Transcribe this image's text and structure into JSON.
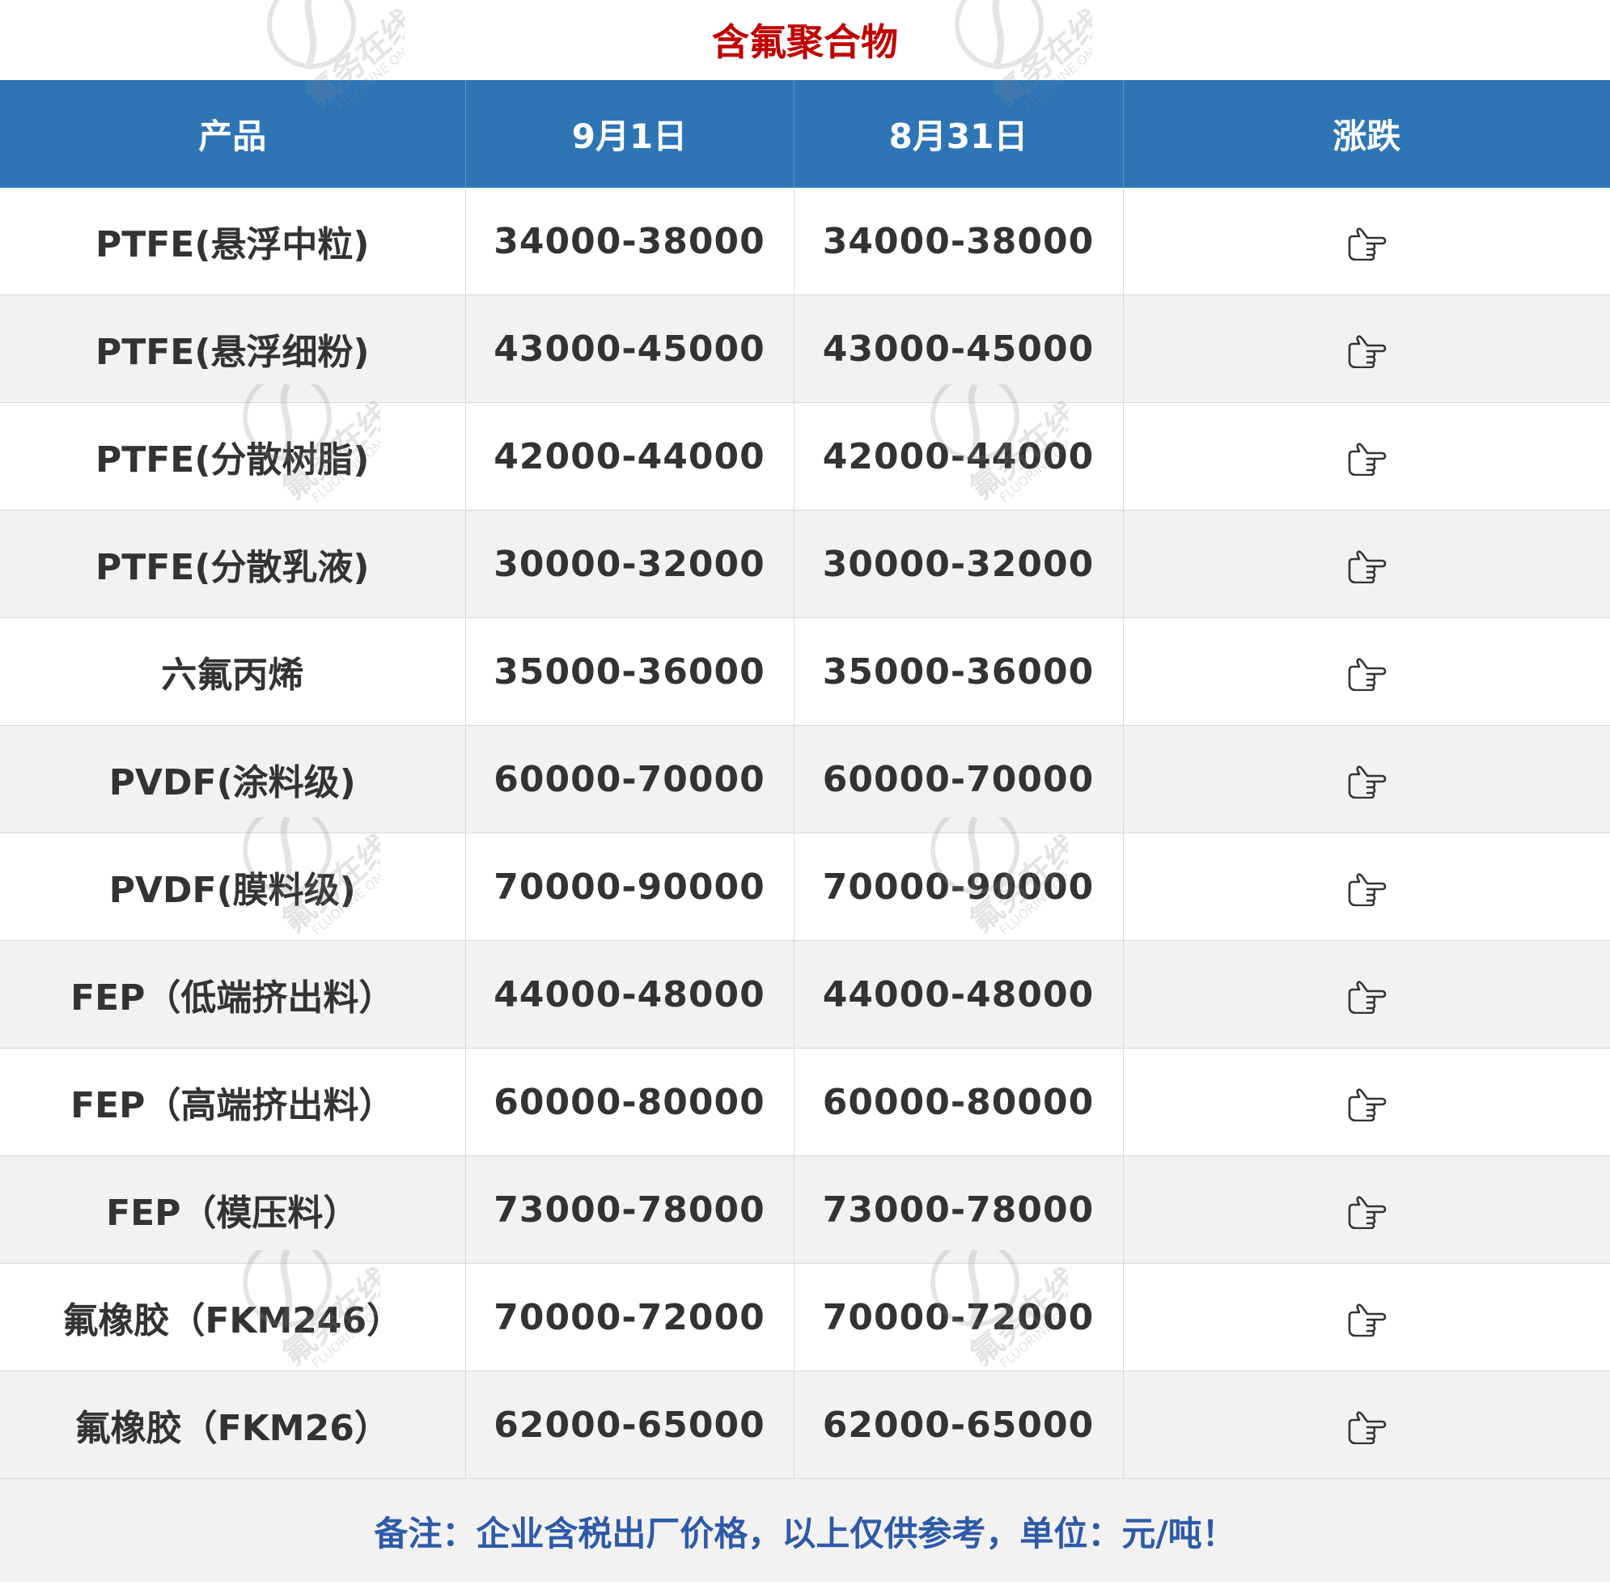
{
  "title": "含氟聚合物",
  "table": {
    "headers": [
      "产品",
      "9月1日",
      "8月31日",
      "涨跌"
    ],
    "rows": [
      {
        "product": "PTFE(悬浮中粒)",
        "sep1": "34000-38000",
        "aug31": "34000-38000",
        "change": "hand-pointing-right-icon"
      },
      {
        "product": "PTFE(悬浮细粉)",
        "sep1": "43000-45000",
        "aug31": "43000-45000",
        "change": "hand-pointing-right-icon"
      },
      {
        "product": "PTFE(分散树脂)",
        "sep1": "42000-44000",
        "aug31": "42000-44000",
        "change": "hand-pointing-right-icon"
      },
      {
        "product": "PTFE(分散乳液)",
        "sep1": "30000-32000",
        "aug31": "30000-32000",
        "change": "hand-pointing-right-icon"
      },
      {
        "product": "六氟丙烯",
        "sep1": "35000-36000",
        "aug31": "35000-36000",
        "change": "hand-pointing-right-icon"
      },
      {
        "product": "PVDF(涂料级)",
        "sep1": "60000-70000",
        "aug31": "60000-70000",
        "change": "hand-pointing-right-icon"
      },
      {
        "product": "PVDF(膜料级)",
        "sep1": "70000-90000",
        "aug31": "70000-90000",
        "change": "hand-pointing-right-icon"
      },
      {
        "product": "FEP（低端挤出料）",
        "sep1": "44000-48000",
        "aug31": "44000-48000",
        "change": "hand-pointing-right-icon"
      },
      {
        "product": "FEP（高端挤出料）",
        "sep1": "60000-80000",
        "aug31": "60000-80000",
        "change": "hand-pointing-right-icon"
      },
      {
        "product": "FEP（模压料）",
        "sep1": "73000-78000",
        "aug31": "73000-78000",
        "change": "hand-pointing-right-icon"
      },
      {
        "product": "氟橡胶（FKM246）",
        "sep1": "70000-72000",
        "aug31": "70000-72000",
        "change": "hand-pointing-right-icon"
      },
      {
        "product": "氟橡胶（FKM26）",
        "sep1": "62000-65000",
        "aug31": "62000-65000",
        "change": "hand-pointing-right-icon"
      }
    ],
    "footnote": "备注：企业含税出厂价格，以上仅供参考，单位：元/吨！"
  },
  "watermark": {
    "text_cn": "氟务在线",
    "text_en": "FLUORINE ONLINE"
  },
  "colors": {
    "title": "#c00000",
    "header_bg": "#2e75b6",
    "header_text": "#ffffff",
    "body_text": "#333333",
    "stripe_bg": "#f2f2f2",
    "footnote_text": "#2e5aa8"
  }
}
